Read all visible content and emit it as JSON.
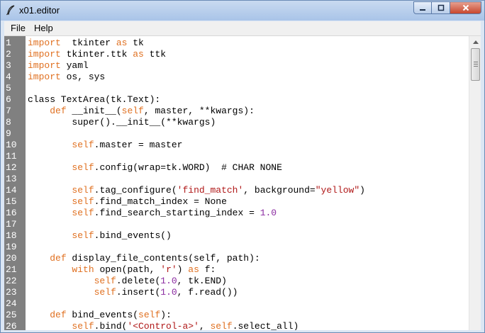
{
  "window": {
    "title": "x01.editor"
  },
  "menu": [
    "File",
    "Help"
  ],
  "lines": [
    {
      "n": "1",
      "tokens": [
        [
          "kw",
          "import"
        ],
        [
          "",
          "  tkinter "
        ],
        [
          "kw",
          "as"
        ],
        [
          "",
          " tk"
        ]
      ]
    },
    {
      "n": "2",
      "tokens": [
        [
          "kw",
          "import"
        ],
        [
          "",
          " tkinter.ttk "
        ],
        [
          "kw",
          "as"
        ],
        [
          "",
          " ttk"
        ]
      ]
    },
    {
      "n": "3",
      "tokens": [
        [
          "kw",
          "import"
        ],
        [
          "",
          " yaml"
        ]
      ]
    },
    {
      "n": "4",
      "tokens": [
        [
          "kw",
          "import"
        ],
        [
          "",
          " os, sys"
        ]
      ]
    },
    {
      "n": "5",
      "tokens": []
    },
    {
      "n": "6",
      "tokens": [
        [
          "",
          "class TextArea(tk.Text):"
        ]
      ]
    },
    {
      "n": "7",
      "tokens": [
        [
          "",
          "    "
        ],
        [
          "kw",
          "def"
        ],
        [
          "",
          " __init__("
        ],
        [
          "self",
          "self"
        ],
        [
          "",
          ", master, **kwargs):"
        ]
      ]
    },
    {
      "n": "8",
      "tokens": [
        [
          "",
          "        super().__init__(**kwargs)"
        ]
      ]
    },
    {
      "n": "9",
      "tokens": []
    },
    {
      "n": "10",
      "tokens": [
        [
          "",
          "        "
        ],
        [
          "self",
          "self"
        ],
        [
          "",
          ".master = master"
        ]
      ]
    },
    {
      "n": "11",
      "tokens": []
    },
    {
      "n": "12",
      "tokens": [
        [
          "",
          "        "
        ],
        [
          "self",
          "self"
        ],
        [
          "",
          ".config(wrap=tk.WORD)  # CHAR NONE"
        ]
      ]
    },
    {
      "n": "13",
      "tokens": []
    },
    {
      "n": "14",
      "tokens": [
        [
          "",
          "        "
        ],
        [
          "self",
          "self"
        ],
        [
          "",
          ".tag_configure("
        ],
        [
          "str",
          "'find_match'"
        ],
        [
          "",
          ", background="
        ],
        [
          "str",
          "\"yellow\""
        ],
        [
          "",
          ")"
        ]
      ]
    },
    {
      "n": "15",
      "tokens": [
        [
          "",
          "        "
        ],
        [
          "self",
          "self"
        ],
        [
          "",
          ".find_match_index = None"
        ]
      ]
    },
    {
      "n": "16",
      "tokens": [
        [
          "",
          "        "
        ],
        [
          "self",
          "self"
        ],
        [
          "",
          ".find_search_starting_index = "
        ],
        [
          "num",
          "1.0"
        ]
      ]
    },
    {
      "n": "17",
      "tokens": []
    },
    {
      "n": "18",
      "tokens": [
        [
          "",
          "        "
        ],
        [
          "self",
          "self"
        ],
        [
          "",
          ".bind_events()"
        ]
      ]
    },
    {
      "n": "19",
      "tokens": []
    },
    {
      "n": "20",
      "tokens": [
        [
          "",
          "    "
        ],
        [
          "kw",
          "def"
        ],
        [
          "",
          " display_file_contents(self, path):"
        ]
      ]
    },
    {
      "n": "21",
      "tokens": [
        [
          "",
          "        "
        ],
        [
          "kw",
          "with"
        ],
        [
          "",
          " open(path, "
        ],
        [
          "str",
          "'r'"
        ],
        [
          "",
          ") "
        ],
        [
          "kw",
          "as"
        ],
        [
          "",
          " f:"
        ]
      ]
    },
    {
      "n": "22",
      "tokens": [
        [
          "",
          "            "
        ],
        [
          "self",
          "self"
        ],
        [
          "",
          ".delete("
        ],
        [
          "num",
          "1.0"
        ],
        [
          "",
          ", tk.END)"
        ]
      ]
    },
    {
      "n": "23",
      "tokens": [
        [
          "",
          "            "
        ],
        [
          "self",
          "self"
        ],
        [
          "",
          ".insert("
        ],
        [
          "num",
          "1.0"
        ],
        [
          "",
          ", f.read())"
        ]
      ]
    },
    {
      "n": "24",
      "tokens": []
    },
    {
      "n": "25",
      "tokens": [
        [
          "",
          "    "
        ],
        [
          "kw",
          "def"
        ],
        [
          "",
          " bind_events("
        ],
        [
          "self",
          "self"
        ],
        [
          "",
          "):"
        ]
      ]
    },
    {
      "n": "26",
      "tokens": [
        [
          "",
          "        "
        ],
        [
          "self",
          "self"
        ],
        [
          "",
          ".bind("
        ],
        [
          "str",
          "'<Control-a>'"
        ],
        [
          "",
          ", "
        ],
        [
          "self",
          "self"
        ],
        [
          "",
          ".select_all)"
        ]
      ]
    }
  ],
  "colors": {
    "keyword": "#e07020",
    "string": "#b01818",
    "number": "#8a2aa0",
    "gutter": "#808080"
  }
}
